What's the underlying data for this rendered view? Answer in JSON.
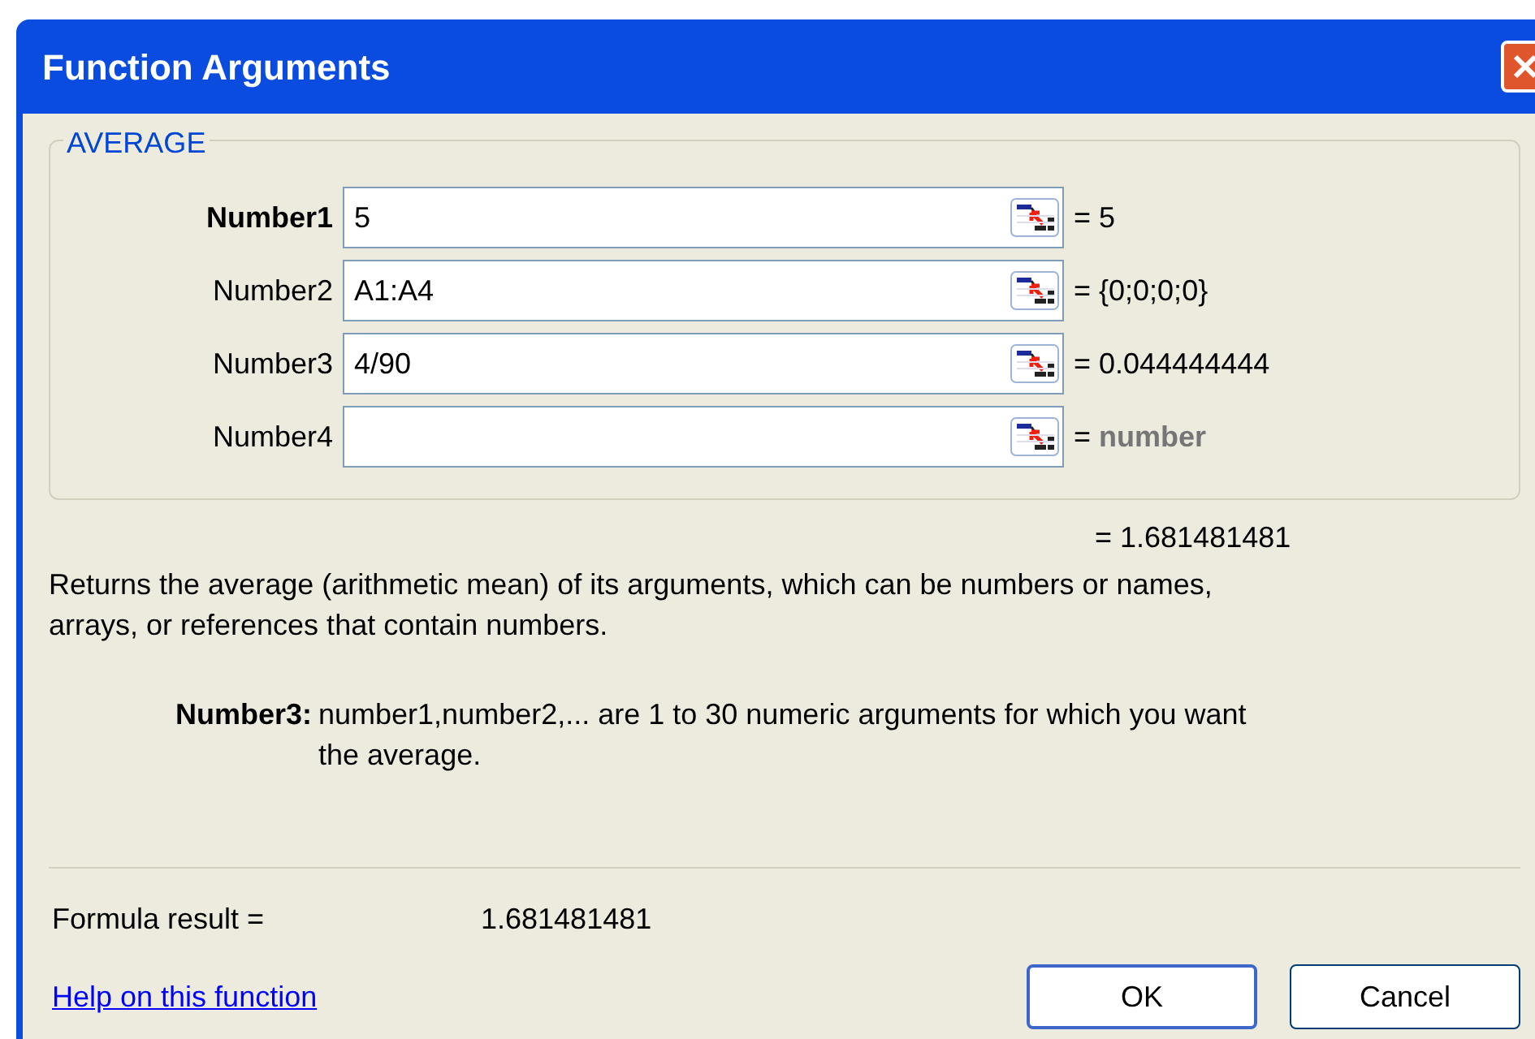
{
  "window": {
    "title": "Function Arguments"
  },
  "group": {
    "title": "AVERAGE",
    "arguments": [
      {
        "label": "Number1",
        "value": "5",
        "active": true,
        "result": "= ",
        "result_value": "5",
        "muted": false
      },
      {
        "label": "Number2",
        "value": "A1:A4",
        "active": false,
        "result": "= ",
        "result_value": "{0;0;0;0}",
        "muted": false
      },
      {
        "label": "Number3",
        "value": "4/90",
        "active": false,
        "result": "= ",
        "result_value": "0.044444444",
        "muted": false
      },
      {
        "label": "Number4",
        "active": false,
        "result": "= ",
        "result_value": "number",
        "muted": true
      }
    ]
  },
  "total": "= 1.681481481",
  "description": "Returns the average (arithmetic mean) of its arguments, which can be numbers or names, arrays, or references that contain numbers.",
  "argument_help": {
    "label": "Number3:",
    "text": "number1,number2,... are 1 to 30 numeric arguments for which you want the average."
  },
  "formula_result": {
    "label": "Formula result =",
    "value": "1.681481481"
  },
  "help_link": "Help on this function",
  "buttons": [
    "OK",
    "Cancel"
  ]
}
